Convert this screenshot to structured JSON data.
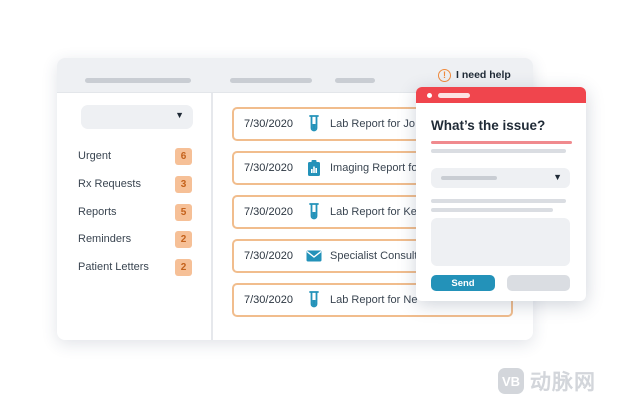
{
  "header": {
    "help_label": "I need help",
    "help_icon": "exclamation-circle-icon"
  },
  "sidebar": {
    "categories": [
      {
        "label": "Urgent",
        "count": "6"
      },
      {
        "label": "Rx Requests",
        "count": "3"
      },
      {
        "label": "Reports",
        "count": "5"
      },
      {
        "label": "Reminders",
        "count": "2"
      },
      {
        "label": "Patient Letters",
        "count": "2"
      }
    ]
  },
  "messages": [
    {
      "date": "7/30/2020",
      "icon": "test-tube-icon",
      "title": "Lab Report for Jo"
    },
    {
      "date": "7/30/2020",
      "icon": "clipboard-chart-icon",
      "title": "Imaging Report fo"
    },
    {
      "date": "7/30/2020",
      "icon": "test-tube-icon",
      "title": "Lab Report for Ke"
    },
    {
      "date": "7/30/2020",
      "icon": "envelope-icon",
      "title": "Specialist Consult"
    },
    {
      "date": "7/30/2020",
      "icon": "test-tube-icon",
      "title": "Lab Report for Ne"
    }
  ],
  "help_panel": {
    "title": "What’s the issue?",
    "send_label": "Send"
  },
  "watermark": {
    "logo": "VB",
    "text": "动脉网"
  },
  "colors": {
    "accent_orange": "#f1bd8d",
    "badge": "#f6c097",
    "panel_header": "#f0454d",
    "send_button": "#2392b9",
    "icon_blue": "#2392b9"
  }
}
